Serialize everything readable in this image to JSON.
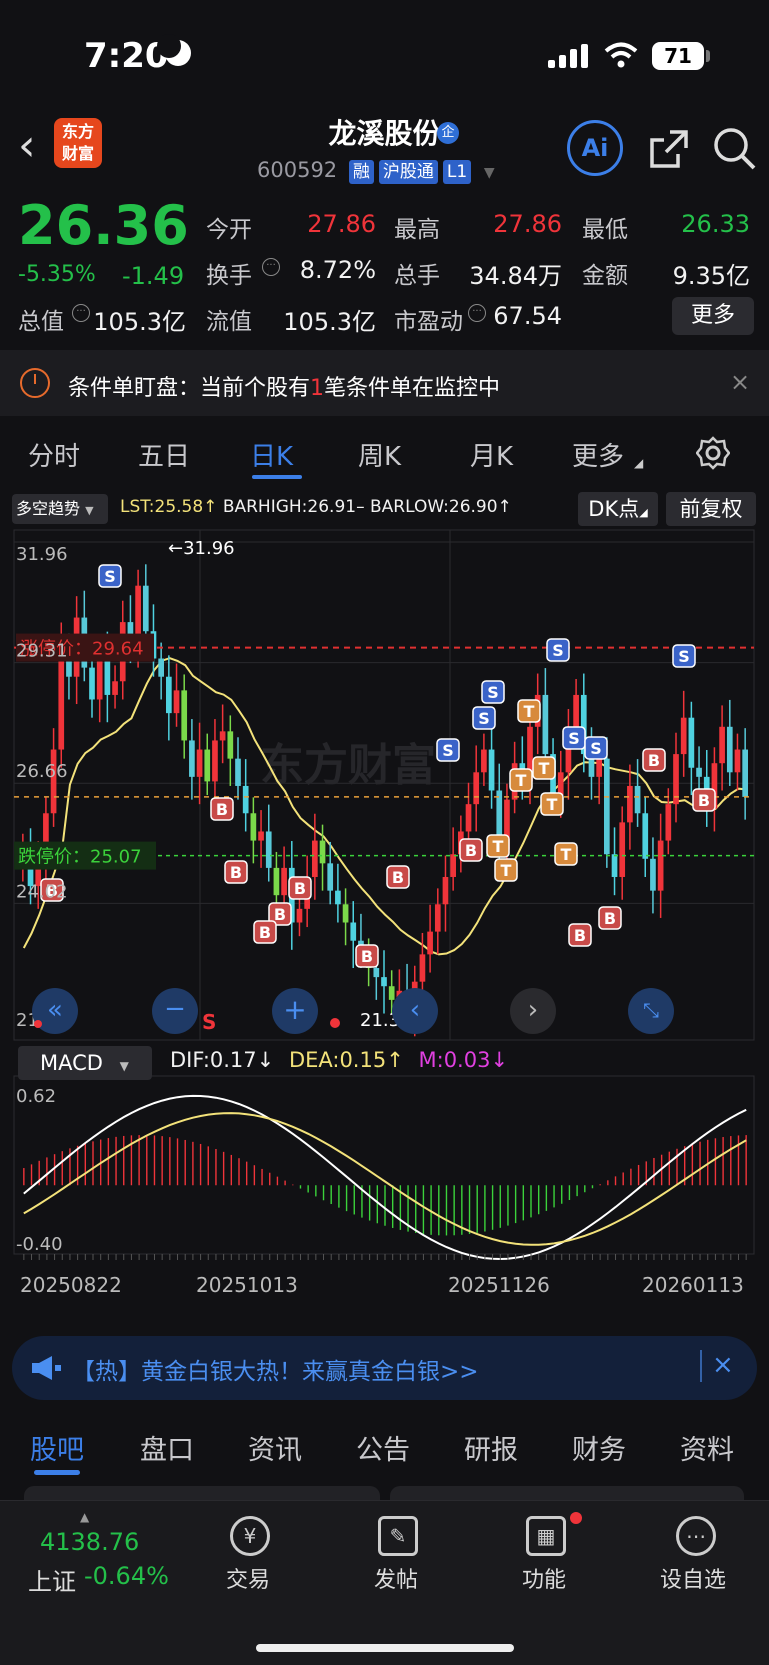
{
  "status_bar": {
    "time": "7:20",
    "battery": "71"
  },
  "header": {
    "logo_text": "东方\n财富",
    "stock_name": "龙溪股份",
    "qi_badge": "企",
    "code": "600592",
    "tags": [
      "融",
      "沪股通",
      "L1"
    ],
    "ai_label": "Ai"
  },
  "quote": {
    "price": "26.36",
    "change_pct": "-5.35%",
    "change_amt": "-1.49",
    "rows": [
      [
        {
          "label": "今开",
          "value": "27.86",
          "color": "red"
        },
        {
          "label": "最高",
          "value": "27.86",
          "color": "red"
        },
        {
          "label": "最低",
          "value": "26.33",
          "color": "green"
        }
      ],
      [
        {
          "label": "换手",
          "value": "8.72%",
          "color": "white"
        },
        {
          "label": "总手",
          "value": "34.84万",
          "color": "white"
        },
        {
          "label": "金额",
          "value": "9.35亿",
          "color": "white"
        }
      ],
      [
        {
          "label": "总值",
          "value": "105.3亿",
          "color": "white"
        },
        {
          "label": "流值",
          "value": "105.3亿",
          "color": "white"
        },
        {
          "label": "市盈动",
          "value": "67.54",
          "color": "white"
        }
      ]
    ],
    "more_label": "更多"
  },
  "alert": {
    "prefix": "条件单盯盘：当前个股有",
    "count": "1",
    "suffix": "笔条件单在监控中"
  },
  "period_tabs": [
    "分时",
    "五日",
    "日K",
    "周K",
    "月K",
    "更多"
  ],
  "indicator_bar": {
    "trend_select": "多空趋势",
    "lst": "LST:25.58↑",
    "barhigh": "BARHIGH:26.91–",
    "barlow": "BARLOW:26.90↑",
    "dk_label": "DK点",
    "adj_label": "前复权"
  },
  "kline": {
    "y_ticks": [
      "31.96",
      "29.31",
      "26.66",
      "24.02",
      "21.37"
    ],
    "high_marker": "←31.96",
    "low_marker": "21.37→",
    "limit_up_label": "涨停价：",
    "limit_up_value": "29.64",
    "limit_down_label": "跌停价：",
    "limit_down_value": "25.07",
    "watermark": "东方财富",
    "s_marker": "S"
  },
  "macd_bar": {
    "select": "MACD",
    "dif": "DIF:0.17↓",
    "dea": "DEA:0.15↑",
    "m": "M:0.03↓",
    "y_ticks": [
      "0.62",
      "-0.40"
    ]
  },
  "x_axis": [
    "20250822",
    "20251013",
    "20251126",
    "20260113"
  ],
  "ad": {
    "text": "【热】黄金白银大热！来赢真金白银>>"
  },
  "content_tabs": [
    "股吧",
    "盘口",
    "资讯",
    "公告",
    "研报",
    "财务",
    "资料"
  ],
  "bottom_bar": {
    "index_value": "4138.76",
    "index_name": "上证",
    "index_change": "-0.64%",
    "nav": [
      {
        "label": "交易",
        "icon": "¥"
      },
      {
        "label": "发帖",
        "icon": "✎"
      },
      {
        "label": "功能",
        "icon": "▦"
      },
      {
        "label": "设自选",
        "icon": "⋯"
      }
    ]
  },
  "colors": {
    "up": "#f0343a",
    "down": "#24c04a",
    "accent": "#3c7fe8",
    "ma": "#f3e27a",
    "limit_up": "#e03030",
    "limit_down": "#3bd23b"
  }
}
